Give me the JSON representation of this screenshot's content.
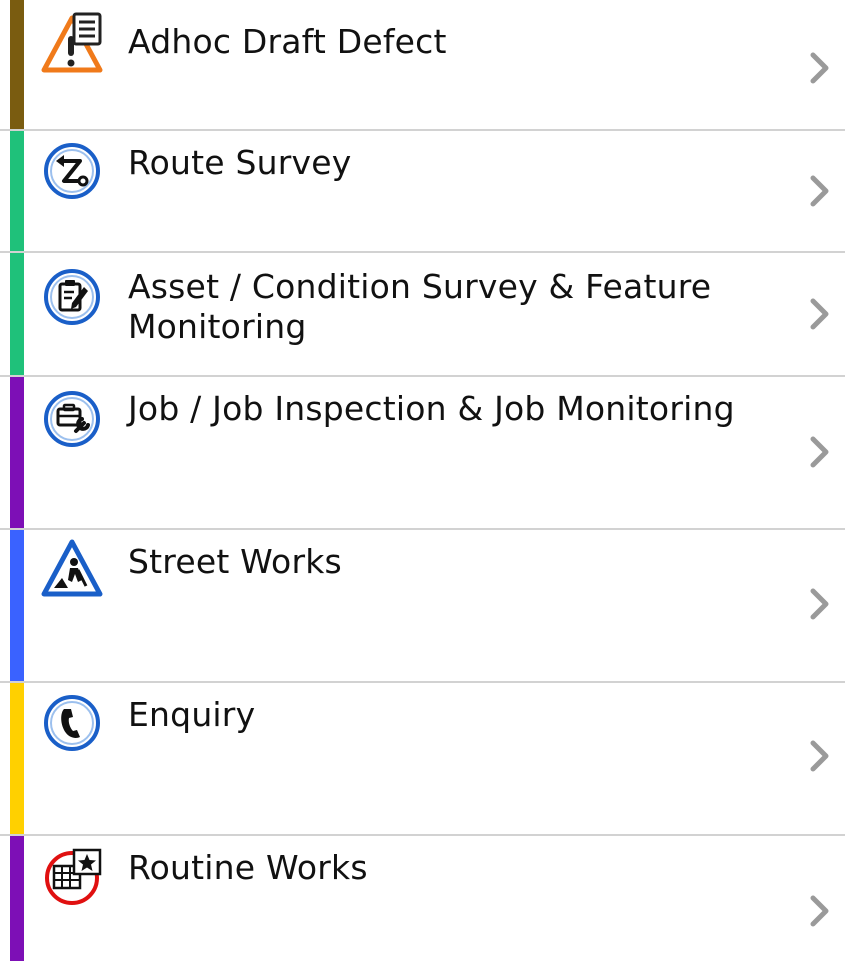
{
  "menu": {
    "items": [
      {
        "label": "Adhoc Draft Defect",
        "icon": "defect-warning-icon",
        "stripe_color": "#7a5c10"
      },
      {
        "label": "Route Survey",
        "icon": "route-survey-icon",
        "stripe_color": "#1fc17a"
      },
      {
        "label": "Asset / Condition Survey & Feature Monitoring",
        "icon": "clipboard-pen-icon",
        "stripe_color": "#1fc17a"
      },
      {
        "label": "Job / Job Inspection & Job Monitoring",
        "icon": "job-tools-icon",
        "stripe_color": "#7d0fb6"
      },
      {
        "label": "Street Works",
        "icon": "road-works-icon",
        "stripe_color": "#3a62ff"
      },
      {
        "label": "Enquiry",
        "icon": "phone-icon",
        "stripe_color": "#ffd000"
      },
      {
        "label": "Routine Works",
        "icon": "calendar-star-icon",
        "stripe_color": "#7d0fb6"
      }
    ]
  }
}
